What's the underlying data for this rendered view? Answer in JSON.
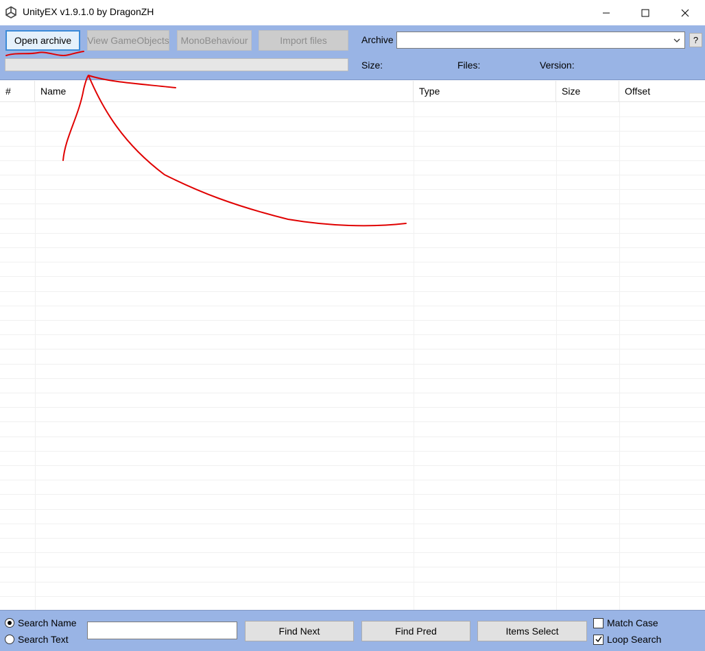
{
  "window": {
    "title": "UnityEX v1.9.1.0 by DragonZH"
  },
  "toolbar": {
    "open_archive": "Open archive",
    "view_gameobjects": "View GameObjects",
    "monobehaviour": "MonoBehaviour",
    "import_files": "Import files"
  },
  "archive_info": {
    "archive_label": "Archive",
    "archive_value": "",
    "help_label": "?",
    "size_label": "Size:",
    "files_label": "Files:",
    "version_label": "Version:"
  },
  "progress": 0,
  "list": {
    "columns": [
      "#",
      "Name",
      "Type",
      "Size",
      "Offset"
    ],
    "rows": []
  },
  "search": {
    "radio_name": "Search Name",
    "radio_text": "Search Text",
    "selected": "name",
    "query": "",
    "find_next": "Find Next",
    "find_pred": "Find Pred",
    "items_select": "Items Select",
    "match_case": "Match Case",
    "match_case_checked": false,
    "loop_search": "Loop Search",
    "loop_search_checked": true
  },
  "colors": {
    "panel": "#99b4e5",
    "annotation": "#e00000",
    "focus_border": "#3a8ad8"
  }
}
